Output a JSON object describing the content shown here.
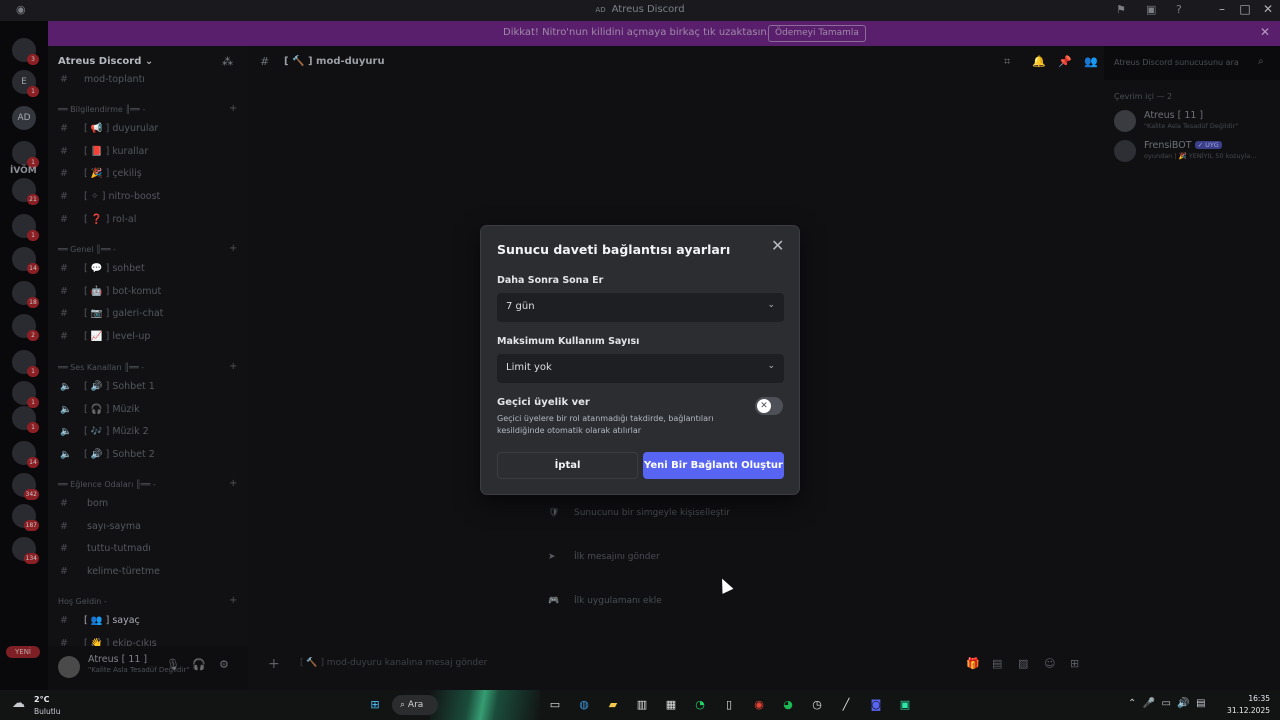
{
  "window": {
    "title": "Atreus Discord",
    "title_prefix": "AD"
  },
  "banner": {
    "text": "Dikkat! Nitro'nun kilidini açmaya birkaç tık uzaktasın.",
    "button": "Ödemeyi Tamamla"
  },
  "rail": {
    "servers": [
      {
        "initials": "",
        "badge": "3"
      },
      {
        "initials": "E",
        "badge": "1"
      },
      {
        "initials": "AD",
        "badge": ""
      },
      {
        "initials": "",
        "badge": "1"
      },
      {
        "initials": "",
        "badge": "21"
      },
      {
        "initials": "",
        "badge": "1"
      },
      {
        "initials": "",
        "badge": "14"
      },
      {
        "initials": "",
        "badge": "18"
      },
      {
        "initials": "",
        "badge": "2"
      },
      {
        "initials": "",
        "badge": "1"
      },
      {
        "initials": "",
        "badge": "1"
      },
      {
        "initials": "",
        "badge": "1"
      },
      {
        "initials": "",
        "badge": "14"
      },
      {
        "initials": "",
        "badge": "342"
      },
      {
        "initials": "",
        "badge": "187"
      },
      {
        "initials": "",
        "badge": "134"
      }
    ],
    "folder_label": "İVÖM",
    "new_label": "YENİ"
  },
  "sidebar": {
    "server_name": "Atreus Discord",
    "channels_top": [
      {
        "prefix": "",
        "name": "mod-toplantı"
      }
    ],
    "categories": [
      {
        "name": "══ Bilgilendirme ║══ -",
        "channels": [
          {
            "prefix": "[ 📢 ]",
            "name": "duyurular"
          },
          {
            "prefix": "[ 📕 ]",
            "name": "kurallar"
          },
          {
            "prefix": "[ 🎉 ]",
            "name": "çekiliş"
          },
          {
            "prefix": "[ ✧ ]",
            "name": "nitro-boost"
          },
          {
            "prefix": "[ ❓ ]",
            "name": "rol-al"
          }
        ]
      },
      {
        "name": "══ Genel ║══ -",
        "channels": [
          {
            "prefix": "[ 💬 ]",
            "name": "sohbet"
          },
          {
            "prefix": "[ 🤖 ]",
            "name": "bot-komut"
          },
          {
            "prefix": "[ 📷 ]",
            "name": "galeri-chat"
          },
          {
            "prefix": "[ 📈 ]",
            "name": "level-up"
          }
        ]
      },
      {
        "name": "══ Ses Kanalları ║══ -",
        "channels": [
          {
            "prefix": "[ 🔊 ]",
            "name": "Sohbet 1"
          },
          {
            "prefix": "[ 🎧 ]",
            "name": "Müzik"
          },
          {
            "prefix": "[ 🎶 ]",
            "name": "Müzik 2"
          },
          {
            "prefix": "[ 🔊 ]",
            "name": "Sohbet 2"
          }
        ]
      },
      {
        "name": "══ Eğlence Odaları ║══ -",
        "channels": [
          {
            "prefix": "",
            "name": "bom"
          },
          {
            "prefix": "",
            "name": "sayı-sayma"
          },
          {
            "prefix": "",
            "name": "tuttu-tutmadı"
          },
          {
            "prefix": "",
            "name": "kelime-türetme"
          }
        ]
      },
      {
        "name": "Hoş Geldin -",
        "channels": [
          {
            "prefix": "[ 👥 ]",
            "name": "sayaç"
          },
          {
            "prefix": "[ 👋 ]",
            "name": "ekip-çıkış"
          }
        ]
      }
    ]
  },
  "user": {
    "name": "Atreus [ 11 ]",
    "status": "\"Kalite Asla Tesadüf Değildir\""
  },
  "channel_header": {
    "name": "[ 🔨 ] mod-duyuru"
  },
  "search": {
    "placeholder": "Atreus Discord sunucusunu ara"
  },
  "onboarding": [
    {
      "icon": "🛡",
      "text": "Sunucunu bir simgeyle kişiselleştir"
    },
    {
      "icon": "➤",
      "text": "İlk mesajını gönder"
    },
    {
      "icon": "🎮",
      "text": "İlk uygulamanı ekle"
    }
  ],
  "composer": {
    "placeholder": "[ 🔨 ] mod-duyuru kanalına mesaj gönder"
  },
  "members": {
    "category": "Çevrim içi — 2",
    "list": [
      {
        "name": "Atreus [ 11 ]",
        "status": "\"Kalite Asla Tesadüf Değildir\"",
        "tag": ""
      },
      {
        "name": "FrensiBOT",
        "status": "oyundan | 🎉 YENİYIL 50 kozuyla...",
        "tag": "✓ UYG"
      }
    ]
  },
  "modal": {
    "title": "Sunucu daveti bağlantısı ayarları",
    "expire_label": "Daha Sonra Sona Er",
    "expire_value": "7 gün",
    "max_uses_label": "Maksimum Kullanım Sayısı",
    "max_uses_value": "Limit yok",
    "temp_title": "Geçici üyelik ver",
    "temp_desc": "Geçici üyelere bir rol atanmadığı takdirde, bağlantıları kesildiğinde otomatik olarak atılırlar",
    "cancel": "İptal",
    "create": "Yeni Bir Bağlantı Oluştur"
  },
  "taskbar": {
    "weather_temp": "2°C",
    "weather_desc": "Bulutlu",
    "search": "Ara",
    "time": "16:35",
    "date": "31.12.2025"
  },
  "colors": {
    "accent": "#5865f2",
    "banner": "#5a1f6c",
    "badge": "#8c1f24"
  }
}
